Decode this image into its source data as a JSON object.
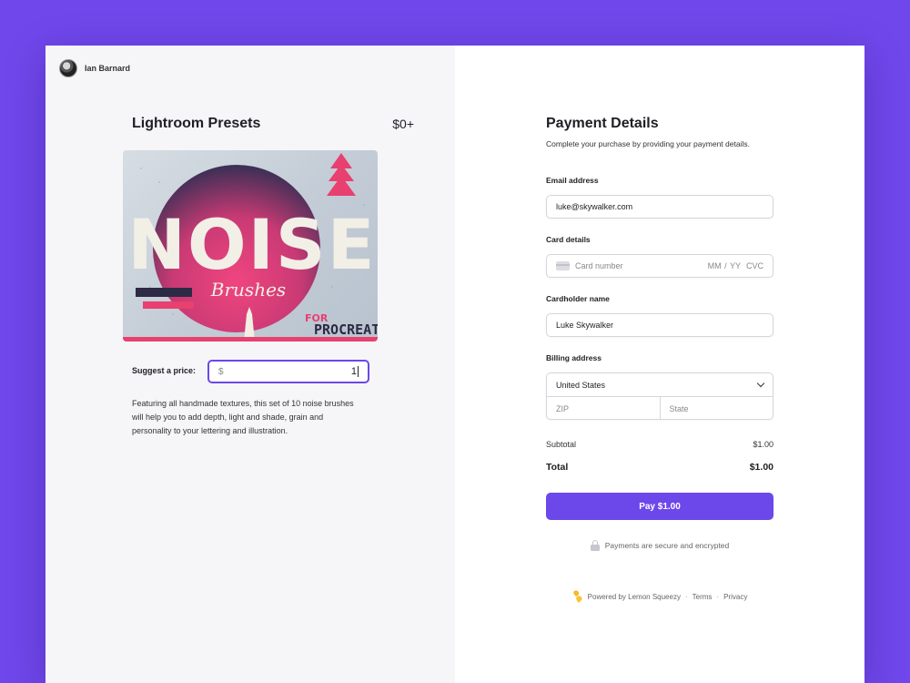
{
  "colors": {
    "background": "#7047eb",
    "accent": "#6c47ea",
    "panel_left": "#f6f6f9",
    "panel_right": "#ffffff"
  },
  "seller": {
    "name": "Ian Barnard",
    "avatar_icon": "user-avatar"
  },
  "product": {
    "title": "Lightroom Presets",
    "price": "$0+",
    "image_text": {
      "main": "NOISE",
      "script": "Brushes",
      "corner_line1": "FOR",
      "corner_line2": "PROCREATE"
    },
    "suggest_label": "Suggest a price:",
    "price_prefix": "$",
    "price_value": "1",
    "description": "Featuring all handmade textures, this set of 10 noise brushes will help you to add depth, light and shade, grain and personality to your lettering and illustration."
  },
  "payment": {
    "title": "Payment Details",
    "subtitle": "Complete your purchase by providing your payment details.",
    "email": {
      "label": "Email address",
      "value": "luke@skywalker.com"
    },
    "card": {
      "label": "Card details",
      "placeholder": "Card number",
      "expiry_placeholder": "MM / YY",
      "cvc_placeholder": "CVC",
      "icon": "credit-card-icon"
    },
    "cardholder": {
      "label": "Cardholder name",
      "value": "Luke Skywalker"
    },
    "billing": {
      "label": "Billing address",
      "country": "United States",
      "zip_placeholder": "ZIP",
      "state_placeholder": "State"
    },
    "subtotal": {
      "label": "Subtotal",
      "value": "$1.00"
    },
    "total": {
      "label": "Total",
      "value": "$1.00"
    },
    "pay_button": "Pay $1.00",
    "secure_note": "Payments are secure and encrypted"
  },
  "footer": {
    "powered_by": "Powered by Lemon Squeezy",
    "separator": "·",
    "terms": "Terms",
    "privacy": "Privacy"
  }
}
